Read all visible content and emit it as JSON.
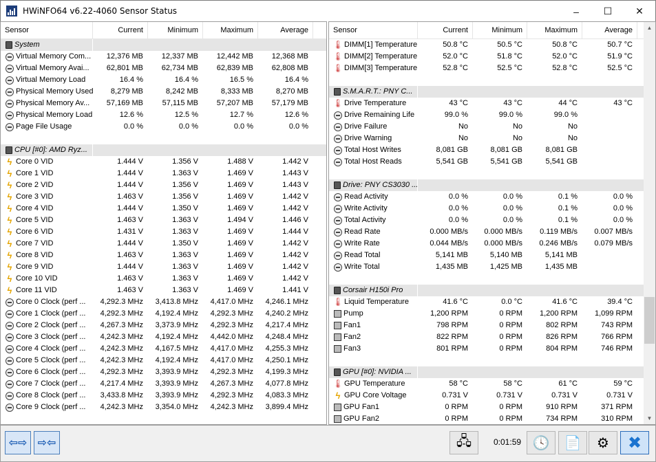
{
  "window": {
    "title": "HWiNFO64 v6.22-4060 Sensor Status",
    "controls": [
      "–",
      "☐",
      "✕"
    ]
  },
  "columns": [
    "Sensor",
    "Current",
    "Minimum",
    "Maximum",
    "Average"
  ],
  "left_rows": [
    {
      "type": "group",
      "label": "System"
    },
    {
      "type": "item",
      "icon": "gauge-icon",
      "label": "Virtual Memory Com...",
      "cur": "12,376 MB",
      "min": "12,337 MB",
      "max": "12,442 MB",
      "avg": "12,368 MB"
    },
    {
      "type": "item",
      "icon": "gauge-icon",
      "label": "Virtual Memory Avai...",
      "cur": "62,801 MB",
      "min": "62,734 MB",
      "max": "62,839 MB",
      "avg": "62,808 MB"
    },
    {
      "type": "item",
      "icon": "gauge-icon",
      "label": "Virtual Memory Load",
      "cur": "16.4 %",
      "min": "16.4 %",
      "max": "16.5 %",
      "avg": "16.4 %"
    },
    {
      "type": "item",
      "icon": "gauge-icon",
      "label": "Physical Memory Used",
      "cur": "8,279 MB",
      "min": "8,242 MB",
      "max": "8,333 MB",
      "avg": "8,270 MB"
    },
    {
      "type": "item",
      "icon": "gauge-icon",
      "label": "Physical Memory Av...",
      "cur": "57,169 MB",
      "min": "57,115 MB",
      "max": "57,207 MB",
      "avg": "57,179 MB"
    },
    {
      "type": "item",
      "icon": "gauge-icon",
      "label": "Physical Memory Load",
      "cur": "12.6 %",
      "min": "12.5 %",
      "max": "12.7 %",
      "avg": "12.6 %"
    },
    {
      "type": "item",
      "icon": "gauge-icon",
      "label": "Page File Usage",
      "cur": "0.0 %",
      "min": "0.0 %",
      "max": "0.0 %",
      "avg": "0.0 %"
    },
    {
      "type": "blank"
    },
    {
      "type": "group",
      "label": "CPU [#0]: AMD Ryz..."
    },
    {
      "type": "item",
      "icon": "volt-icon",
      "label": "Core 0 VID",
      "cur": "1.444 V",
      "min": "1.356 V",
      "max": "1.488 V",
      "avg": "1.442 V"
    },
    {
      "type": "item",
      "icon": "volt-icon",
      "label": "Core 1 VID",
      "cur": "1.444 V",
      "min": "1.363 V",
      "max": "1.469 V",
      "avg": "1.443 V"
    },
    {
      "type": "item",
      "icon": "volt-icon",
      "label": "Core 2 VID",
      "cur": "1.444 V",
      "min": "1.356 V",
      "max": "1.469 V",
      "avg": "1.443 V"
    },
    {
      "type": "item",
      "icon": "volt-icon",
      "label": "Core 3 VID",
      "cur": "1.463 V",
      "min": "1.356 V",
      "max": "1.469 V",
      "avg": "1.442 V"
    },
    {
      "type": "item",
      "icon": "volt-icon",
      "label": "Core 4 VID",
      "cur": "1.444 V",
      "min": "1.350 V",
      "max": "1.469 V",
      "avg": "1.442 V"
    },
    {
      "type": "item",
      "icon": "volt-icon",
      "label": "Core 5 VID",
      "cur": "1.463 V",
      "min": "1.363 V",
      "max": "1.494 V",
      "avg": "1.446 V"
    },
    {
      "type": "item",
      "icon": "volt-icon",
      "label": "Core 6 VID",
      "cur": "1.431 V",
      "min": "1.363 V",
      "max": "1.469 V",
      "avg": "1.444 V"
    },
    {
      "type": "item",
      "icon": "volt-icon",
      "label": "Core 7 VID",
      "cur": "1.444 V",
      "min": "1.350 V",
      "max": "1.469 V",
      "avg": "1.442 V"
    },
    {
      "type": "item",
      "icon": "volt-icon",
      "label": "Core 8 VID",
      "cur": "1.463 V",
      "min": "1.363 V",
      "max": "1.469 V",
      "avg": "1.442 V"
    },
    {
      "type": "item",
      "icon": "volt-icon",
      "label": "Core 9 VID",
      "cur": "1.444 V",
      "min": "1.363 V",
      "max": "1.469 V",
      "avg": "1.442 V"
    },
    {
      "type": "item",
      "icon": "volt-icon",
      "label": "Core 10 VID",
      "cur": "1.463 V",
      "min": "1.363 V",
      "max": "1.469 V",
      "avg": "1.442 V"
    },
    {
      "type": "item",
      "icon": "volt-icon",
      "label": "Core 11 VID",
      "cur": "1.463 V",
      "min": "1.363 V",
      "max": "1.469 V",
      "avg": "1.441 V"
    },
    {
      "type": "item",
      "icon": "gauge-icon",
      "label": "Core 0 Clock (perf ...",
      "cur": "4,292.3 MHz",
      "min": "3,413.8 MHz",
      "max": "4,417.0 MHz",
      "avg": "4,246.1 MHz"
    },
    {
      "type": "item",
      "icon": "gauge-icon",
      "label": "Core 1 Clock (perf ...",
      "cur": "4,292.3 MHz",
      "min": "4,192.4 MHz",
      "max": "4,292.3 MHz",
      "avg": "4,240.2 MHz"
    },
    {
      "type": "item",
      "icon": "gauge-icon",
      "label": "Core 2 Clock (perf ...",
      "cur": "4,267.3 MHz",
      "min": "3,373.9 MHz",
      "max": "4,292.3 MHz",
      "avg": "4,217.4 MHz"
    },
    {
      "type": "item",
      "icon": "gauge-icon",
      "label": "Core 3 Clock (perf ...",
      "cur": "4,242.3 MHz",
      "min": "4,192.4 MHz",
      "max": "4,442.0 MHz",
      "avg": "4,248.4 MHz"
    },
    {
      "type": "item",
      "icon": "gauge-icon",
      "label": "Core 4 Clock (perf ...",
      "cur": "4,242.3 MHz",
      "min": "4,167.5 MHz",
      "max": "4,417.0 MHz",
      "avg": "4,255.3 MHz"
    },
    {
      "type": "item",
      "icon": "gauge-icon",
      "label": "Core 5 Clock (perf ...",
      "cur": "4,242.3 MHz",
      "min": "4,192.4 MHz",
      "max": "4,417.0 MHz",
      "avg": "4,250.1 MHz"
    },
    {
      "type": "item",
      "icon": "gauge-icon",
      "label": "Core 6 Clock (perf ...",
      "cur": "4,292.3 MHz",
      "min": "3,393.9 MHz",
      "max": "4,292.3 MHz",
      "avg": "4,199.3 MHz"
    },
    {
      "type": "item",
      "icon": "gauge-icon",
      "label": "Core 7 Clock (perf ...",
      "cur": "4,217.4 MHz",
      "min": "3,393.9 MHz",
      "max": "4,267.3 MHz",
      "avg": "4,077.8 MHz"
    },
    {
      "type": "item",
      "icon": "gauge-icon",
      "label": "Core 8 Clock (perf ...",
      "cur": "3,433.8 MHz",
      "min": "3,393.9 MHz",
      "max": "4,292.3 MHz",
      "avg": "4,083.3 MHz"
    },
    {
      "type": "item",
      "icon": "gauge-icon",
      "label": "Core 9 Clock (perf ...",
      "cur": "4,242.3 MHz",
      "min": "3,354.0 MHz",
      "max": "4,242.3 MHz",
      "avg": "3,899.4 MHz"
    }
  ],
  "right_rows": [
    {
      "type": "item",
      "icon": "thermometer-icon",
      "label": "DIMM[1] Temperature",
      "cur": "50.8 °C",
      "min": "50.5 °C",
      "max": "50.8 °C",
      "avg": "50.7 °C"
    },
    {
      "type": "item",
      "icon": "thermometer-icon",
      "label": "DIMM[2] Temperature",
      "cur": "52.0 °C",
      "min": "51.8 °C",
      "max": "52.0 °C",
      "avg": "51.9 °C"
    },
    {
      "type": "item",
      "icon": "thermometer-icon",
      "label": "DIMM[3] Temperature",
      "cur": "52.8 °C",
      "min": "52.5 °C",
      "max": "52.8 °C",
      "avg": "52.5 °C"
    },
    {
      "type": "blank"
    },
    {
      "type": "group",
      "label": "S.M.A.R.T.: PNY C..."
    },
    {
      "type": "item",
      "icon": "thermometer-icon",
      "label": "Drive Temperature",
      "cur": "43 °C",
      "min": "43 °C",
      "max": "44 °C",
      "avg": "43 °C"
    },
    {
      "type": "item",
      "icon": "gauge-icon",
      "label": "Drive Remaining Life",
      "cur": "99.0 %",
      "min": "99.0 %",
      "max": "99.0 %",
      "avg": ""
    },
    {
      "type": "item",
      "icon": "gauge-icon",
      "label": "Drive Failure",
      "cur": "No",
      "min": "No",
      "max": "No",
      "avg": ""
    },
    {
      "type": "item",
      "icon": "gauge-icon",
      "label": "Drive Warning",
      "cur": "No",
      "min": "No",
      "max": "No",
      "avg": ""
    },
    {
      "type": "item",
      "icon": "gauge-icon",
      "label": "Total Host Writes",
      "cur": "8,081 GB",
      "min": "8,081 GB",
      "max": "8,081 GB",
      "avg": ""
    },
    {
      "type": "item",
      "icon": "gauge-icon",
      "label": "Total Host Reads",
      "cur": "5,541 GB",
      "min": "5,541 GB",
      "max": "5,541 GB",
      "avg": ""
    },
    {
      "type": "blank"
    },
    {
      "type": "group",
      "label": "Drive: PNY CS3030 ..."
    },
    {
      "type": "item",
      "icon": "gauge-icon",
      "label": "Read Activity",
      "cur": "0.0 %",
      "min": "0.0 %",
      "max": "0.1 %",
      "avg": "0.0 %"
    },
    {
      "type": "item",
      "icon": "gauge-icon",
      "label": "Write Activity",
      "cur": "0.0 %",
      "min": "0.0 %",
      "max": "0.1 %",
      "avg": "0.0 %"
    },
    {
      "type": "item",
      "icon": "gauge-icon",
      "label": "Total Activity",
      "cur": "0.0 %",
      "min": "0.0 %",
      "max": "0.1 %",
      "avg": "0.0 %"
    },
    {
      "type": "item",
      "icon": "gauge-icon",
      "label": "Read Rate",
      "cur": "0.000 MB/s",
      "min": "0.000 MB/s",
      "max": "0.119 MB/s",
      "avg": "0.007 MB/s"
    },
    {
      "type": "item",
      "icon": "gauge-icon",
      "label": "Write Rate",
      "cur": "0.044 MB/s",
      "min": "0.000 MB/s",
      "max": "0.246 MB/s",
      "avg": "0.079 MB/s"
    },
    {
      "type": "item",
      "icon": "gauge-icon",
      "label": "Read Total",
      "cur": "5,141 MB",
      "min": "5,140 MB",
      "max": "5,141 MB",
      "avg": ""
    },
    {
      "type": "item",
      "icon": "gauge-icon",
      "label": "Write Total",
      "cur": "1,435 MB",
      "min": "1,425 MB",
      "max": "1,435 MB",
      "avg": ""
    },
    {
      "type": "blank"
    },
    {
      "type": "group",
      "label": "Corsair H150i Pro"
    },
    {
      "type": "item",
      "icon": "thermometer-icon",
      "label": "Liquid Temperature",
      "cur": "41.6 °C",
      "min": "0.0 °C",
      "max": "41.6 °C",
      "avg": "39.4 °C"
    },
    {
      "type": "item",
      "icon": "fan-icon",
      "label": "Pump",
      "cur": "1,200 RPM",
      "min": "0 RPM",
      "max": "1,200 RPM",
      "avg": "1,099 RPM"
    },
    {
      "type": "item",
      "icon": "fan-icon",
      "label": "Fan1",
      "cur": "798 RPM",
      "min": "0 RPM",
      "max": "802 RPM",
      "avg": "743 RPM"
    },
    {
      "type": "item",
      "icon": "fan-icon",
      "label": "Fan2",
      "cur": "822 RPM",
      "min": "0 RPM",
      "max": "826 RPM",
      "avg": "766 RPM"
    },
    {
      "type": "item",
      "icon": "fan-icon",
      "label": "Fan3",
      "cur": "801 RPM",
      "min": "0 RPM",
      "max": "804 RPM",
      "avg": "746 RPM"
    },
    {
      "type": "blank"
    },
    {
      "type": "group",
      "label": "GPU [#0]: NVIDIA ..."
    },
    {
      "type": "item",
      "icon": "thermometer-icon",
      "label": "GPU Temperature",
      "cur": "58 °C",
      "min": "58 °C",
      "max": "61 °C",
      "avg": "59 °C"
    },
    {
      "type": "item",
      "icon": "volt-icon",
      "label": "GPU Core Voltage",
      "cur": "0.731 V",
      "min": "0.731 V",
      "max": "0.731 V",
      "avg": "0.731 V"
    },
    {
      "type": "item",
      "icon": "fan-icon",
      "label": "GPU Fan1",
      "cur": "0 RPM",
      "min": "0 RPM",
      "max": "910 RPM",
      "avg": "371 RPM"
    },
    {
      "type": "item",
      "icon": "fan-icon",
      "label": "GPU Fan2",
      "cur": "0 RPM",
      "min": "0 RPM",
      "max": "734 RPM",
      "avg": "310 RPM"
    }
  ],
  "bottombar": {
    "nav_left": "⇦⇨",
    "nav_right": "⇨⇦",
    "timer": "0:01:59",
    "icons": [
      "network-icon",
      "clock-icon",
      "add-report-icon",
      "settings-icon",
      "close-icon"
    ]
  }
}
